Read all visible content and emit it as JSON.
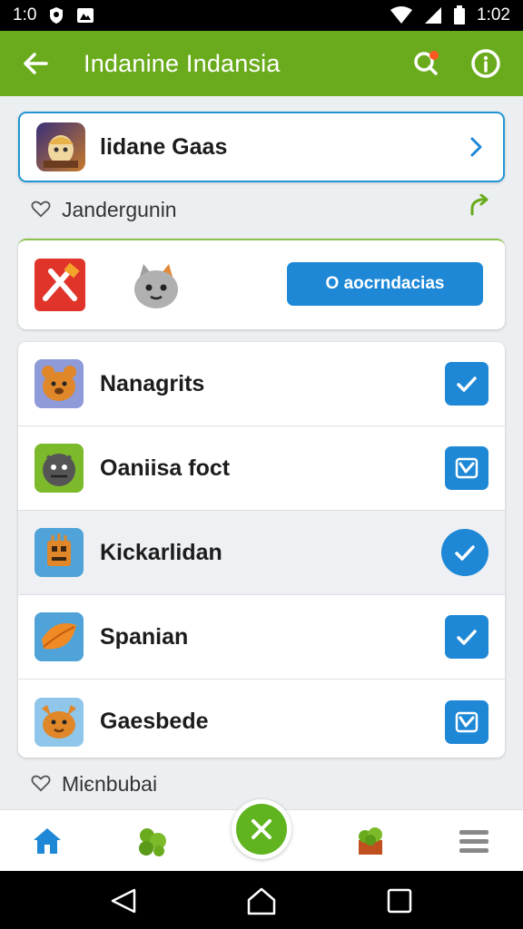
{
  "status_bar": {
    "left_time": "1:0",
    "right_time": "1:02",
    "icons": [
      "shield-icon",
      "photo-icon",
      "wifi-icon",
      "signal-icon",
      "battery-icon"
    ]
  },
  "app_bar": {
    "title": "Indanine Indansia",
    "icons": [
      "back-arrow-icon",
      "search-notification-icon",
      "info-icon"
    ],
    "color": "#6aab1d"
  },
  "featured": {
    "name": "lidane Gaas"
  },
  "section1": {
    "label": "Jandergunin"
  },
  "promo": {
    "button_label": "O aocrndacias"
  },
  "list": {
    "items": [
      {
        "label": "Nanagrits",
        "checked": true
      },
      {
        "label": "Oaniisa foct",
        "checked": true
      },
      {
        "label": "Kickarlidan",
        "checked": true
      },
      {
        "label": "Spanian",
        "checked": true
      },
      {
        "label": "Gaesbede",
        "checked": true
      }
    ]
  },
  "section2": {
    "label": "Miєnbubai"
  },
  "bottom_nav": {
    "items": [
      "home-icon",
      "leaves-icon",
      "close-fab-icon",
      "plant-icon",
      "menu-icon"
    ]
  },
  "colors": {
    "accent": "#1e88d6",
    "brand": "#6aab1d"
  }
}
